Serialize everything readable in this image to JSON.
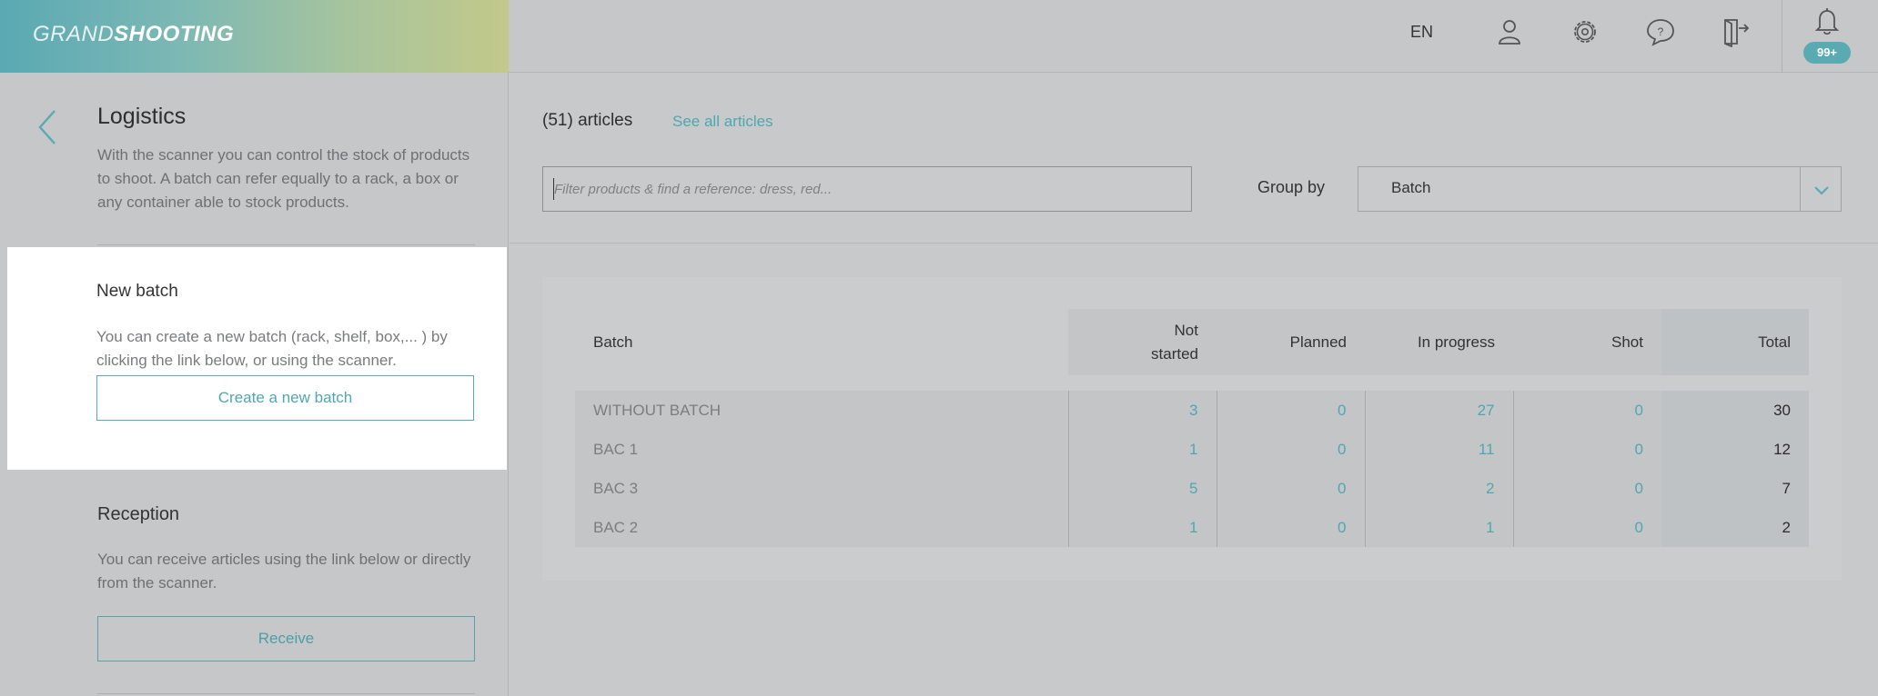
{
  "header": {
    "logo_light": "GRAND",
    "logo_bold": "SHOOTING",
    "language": "EN",
    "icons": [
      "user-icon",
      "gear-icon",
      "help-bubble-icon",
      "logout-door-icon",
      "bell-icon"
    ],
    "notifications_badge": "99+"
  },
  "sidebar": {
    "title": "Logistics",
    "description": "With the scanner you can control the stock of products to shoot. A batch can refer equally to a rack, a box or any container able to stock products.",
    "new_batch": {
      "title": "New batch",
      "description": "You can create a new batch (rack, shelf, box,... ) by clicking the link below, or using the scanner.",
      "button": "Create a new batch"
    },
    "reception": {
      "title": "Reception",
      "description": "You can receive articles using the link below or directly from the scanner.",
      "button": "Receive"
    }
  },
  "main": {
    "articles_count": "(51) articles",
    "see_all": "See all articles",
    "filter_placeholder": "Filter products & find a reference: dress, red...",
    "group_by_label": "Group by",
    "group_by_value": "Batch",
    "table": {
      "headers": [
        "Batch",
        "Not started",
        "Planned",
        "In progress",
        "Shot",
        "Total"
      ],
      "rows": [
        {
          "batch": "WITHOUT BATCH",
          "not_started": "3",
          "planned": "0",
          "in_progress": "27",
          "shot": "0",
          "total": "30"
        },
        {
          "batch": "BAC 1",
          "not_started": "1",
          "planned": "0",
          "in_progress": "11",
          "shot": "0",
          "total": "12"
        },
        {
          "batch": "BAC 3",
          "not_started": "5",
          "planned": "0",
          "in_progress": "2",
          "shot": "0",
          "total": "7"
        },
        {
          "batch": "BAC 2",
          "not_started": "1",
          "planned": "0",
          "in_progress": "1",
          "shot": "0",
          "total": "2"
        }
      ]
    }
  },
  "colors": {
    "accent": "#5aaab3",
    "overlay_gray": "#c6c7c9",
    "card_white": "#ffffff"
  }
}
